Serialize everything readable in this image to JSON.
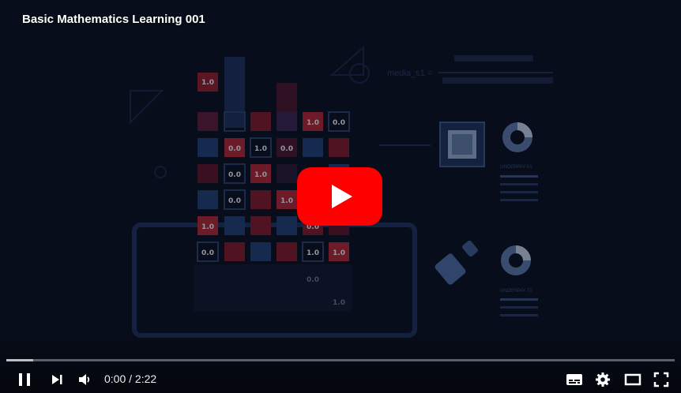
{
  "player": {
    "title": "Basic Mathematics Learning 001",
    "time": {
      "current": "0:00",
      "separator": " / ",
      "duration": "2:22"
    },
    "progress_played_fraction": 0.0,
    "progress_loaded_fraction": 0.04
  },
  "video_frame": {
    "matrix_cells": [
      "1.0",
      "1.0",
      "0.0",
      "0.0",
      "1.0",
      "0.0",
      "0.0",
      "1.0",
      "0.0",
      "1.0",
      "1.0",
      "0.0",
      "0.0",
      "1.0",
      "1.0",
      "0.0",
      "1.0"
    ],
    "formula_text": "media_s1 =",
    "card_labels": [
      "UNDERPAY-01",
      "UNDERPAY-71"
    ]
  },
  "colors": {
    "accent": "#ff0000",
    "background": "#0b1428"
  },
  "icons": [
    "youtube-play-icon",
    "pause-icon",
    "next-icon",
    "volume-icon",
    "subtitles-icon",
    "settings-icon",
    "theater-icon",
    "fullscreen-icon"
  ]
}
